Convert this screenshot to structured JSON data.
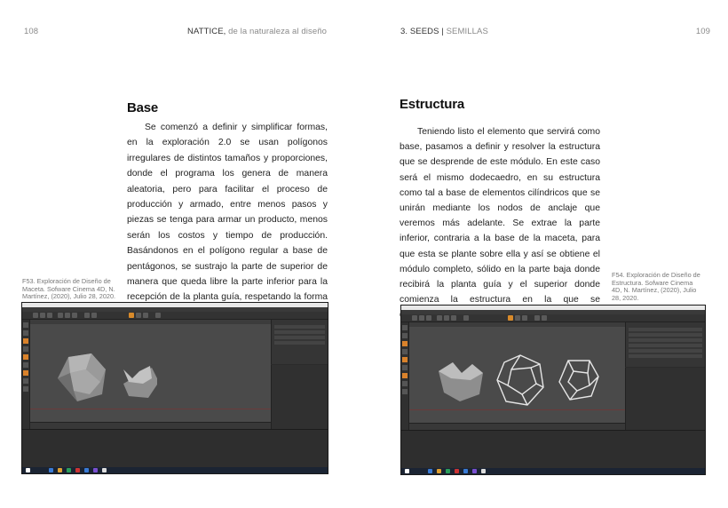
{
  "left_page": {
    "page_number": "108",
    "running_head_title": "NATTICE,",
    "running_head_subtitle": " de la naturaleza al diseño",
    "heading": "Base",
    "paragraph": "Se comenzó a definir y simplificar formas, en la exploración 2.0 se usan polígonos irregulares de distintos tamaños y proporciones, donde el programa los genera de manera aleatoria, pero para facilitar el proceso de producción y armado, entre menos pasos y piezas se tenga para armar un producto, menos serán los costos y tiempo de producción. Basándonos en el polígono regular a base de pentágonos, se sustrajo la parte de superior de manera que queda libre la parte inferior para la recepción de la planta guía, respetando la forma y quedando lista para recibir la estructura que se basa de igual manera en un dodecaedro.",
    "caption": "F53. Exploración de Diseño de Maceta. Sofware Cinema 4D, N. Martínez, (2020), Julio 28, 2020."
  },
  "right_page": {
    "page_number": "109",
    "running_head_section": "3. SEEDS",
    "running_head_separator": " | ",
    "running_head_sub": "SEMILLAS",
    "heading": "Estructura",
    "paragraph": "Teniendo listo el elemento que servirá como base, pasamos a definir y resolver la estructura que se desprende de este módulo. En este caso será el mismo dodecaedro, en su estructura como tal a base de elementos cilíndricos que se unirán mediante los nodos de anclaje que veremos más adelante. Se extrae la parte inferior, contraria a la base de la maceta, para que esta se plante sobre ella y así se obtiene el módulo completo, sólido en la parte baja donde recibirá la planta guía y el superior donde comienza la estructura en la que se desenvolverá nuestra trepadora.",
    "caption": "F54. Exploración de Diseño de Estructura. Sofware Cinema 4D, N. Martínez, (2020), Julio 28, 2020."
  },
  "colors": {
    "page_bg": "#ffffff",
    "c4d_bg": "#2b2b2b",
    "viewport": "#4a4a4a",
    "accent_orange": "#d88a2a"
  },
  "icons": [
    "cinema4d-viewport-screenshot",
    "dodecahedron-solid",
    "dodecahedron-wireframe",
    "windows-taskbar"
  ]
}
